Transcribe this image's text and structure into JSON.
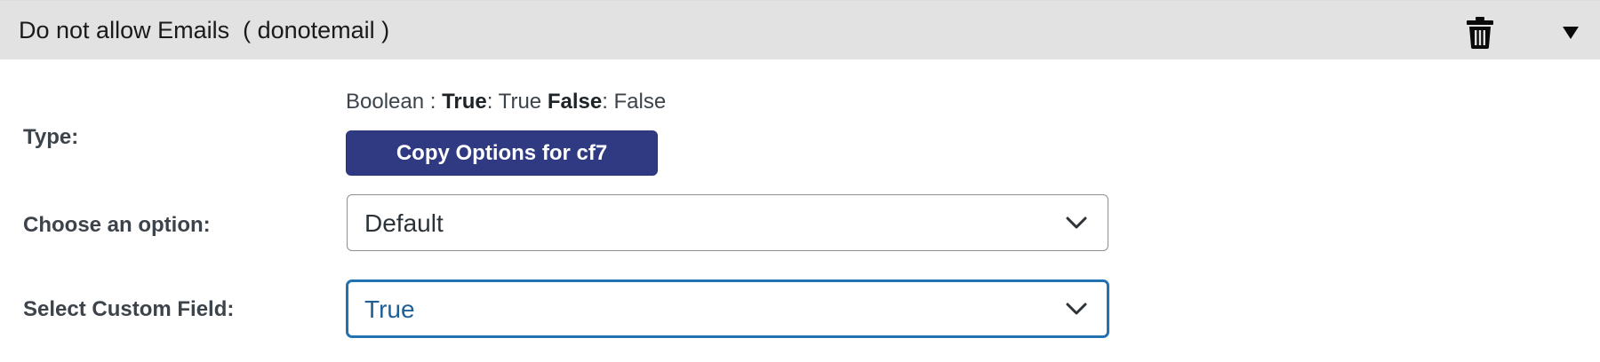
{
  "header": {
    "title": "Do not allow Emails  ( donotemail )",
    "delete_icon": "trash-icon",
    "toggle_icon": "triangle-down-icon"
  },
  "type_row": {
    "label": "Type:",
    "description": {
      "prefix": "Boolean : ",
      "true_label": "True",
      "true_value": ": True ",
      "false_label": "False",
      "false_value": ": False"
    },
    "copy_button": "Copy Options for cf7"
  },
  "option_row": {
    "label": "Choose an option:",
    "selected": "Default"
  },
  "custom_field_row": {
    "label": "Select Custom Field:",
    "selected": "True"
  },
  "colors": {
    "header_bg": "#e2e2e2",
    "button_bg": "#2f3a82",
    "focus_border": "#2271b1"
  }
}
